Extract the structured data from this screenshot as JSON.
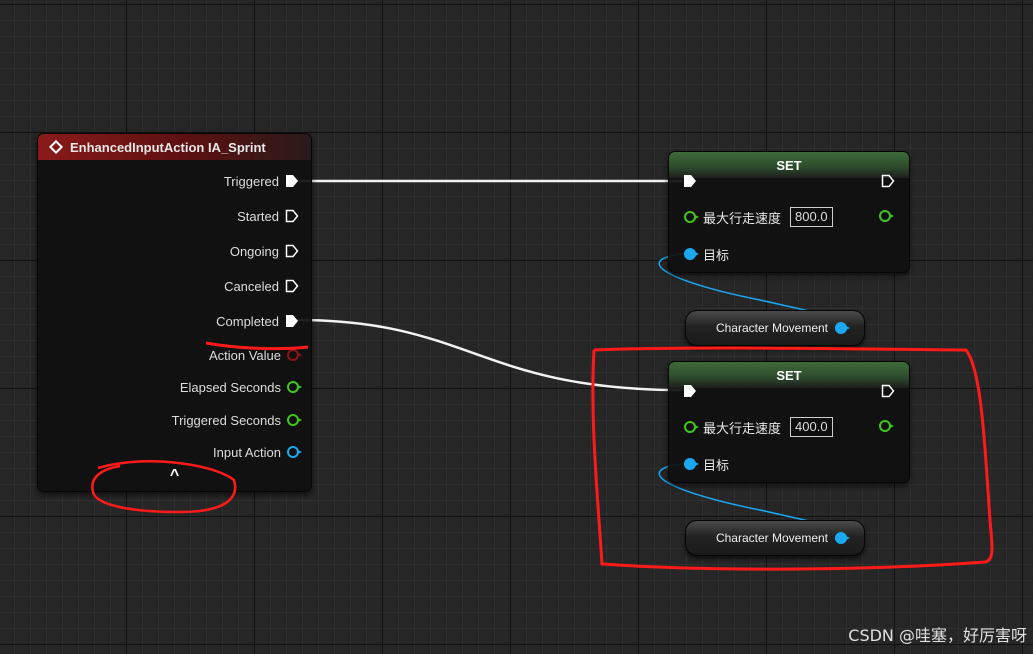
{
  "event_node": {
    "title": "EnhancedInputAction IA_Sprint",
    "exec_outputs": [
      "Triggered",
      "Started",
      "Ongoing",
      "Canceled",
      "Completed"
    ],
    "data_outputs": [
      "Action Value",
      "Elapsed Seconds",
      "Triggered Seconds",
      "Input Action"
    ],
    "collapse_glyph": "^"
  },
  "set_nodes": [
    {
      "title": "SET",
      "property_label": "最大行走速度",
      "value": "800.0",
      "target_label": "目标"
    },
    {
      "title": "SET",
      "property_label": "最大行走速度",
      "value": "400.0",
      "target_label": "目标"
    }
  ],
  "movement_nodes": [
    "Character Movement",
    "Character Movement"
  ],
  "colors": {
    "exec_wire": "#ffffff",
    "object_wire": "#1aa8f0",
    "float_pin": "#41c51e",
    "annotation": "#ff1a1a",
    "event_header": "#8a1a1a",
    "set_header": "#3e6b3a"
  },
  "watermark": "CSDN @哇塞，好厉害呀"
}
